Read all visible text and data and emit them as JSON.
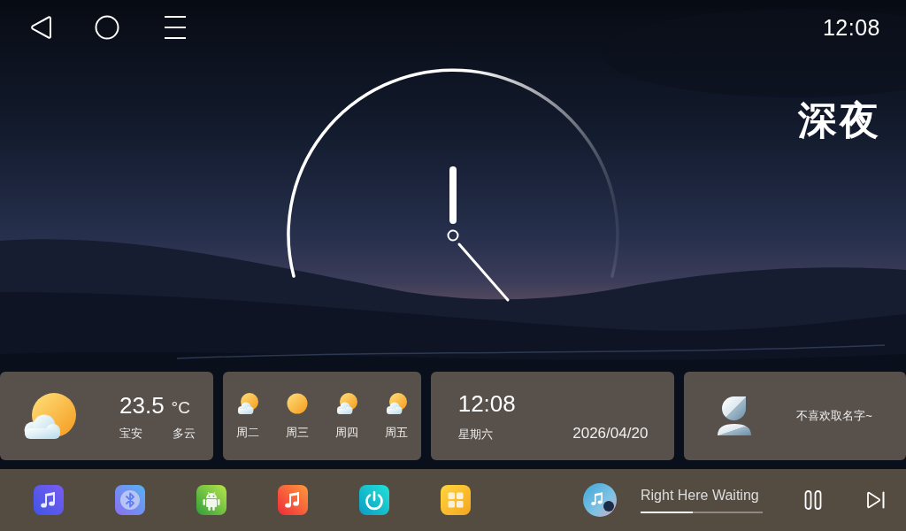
{
  "status_bar": {
    "time": "12:08"
  },
  "time_of_day": "深夜",
  "weather": {
    "temperature": "23.5",
    "unit": "°C",
    "city": "宝安",
    "condition": "多云"
  },
  "forecast": [
    {
      "day": "周二",
      "kind": "partly_cloudy"
    },
    {
      "day": "周三",
      "kind": "sunny"
    },
    {
      "day": "周四",
      "kind": "partly_cloudy"
    },
    {
      "day": "周五",
      "kind": "partly_cloudy"
    }
  ],
  "date_card": {
    "time": "12:08",
    "weekday": "星期六",
    "date": "2026/04/20"
  },
  "profile": {
    "name": "不喜欢取名字~"
  },
  "player": {
    "title": "Right Here Waiting",
    "level": 0.43,
    "playing": true
  }
}
